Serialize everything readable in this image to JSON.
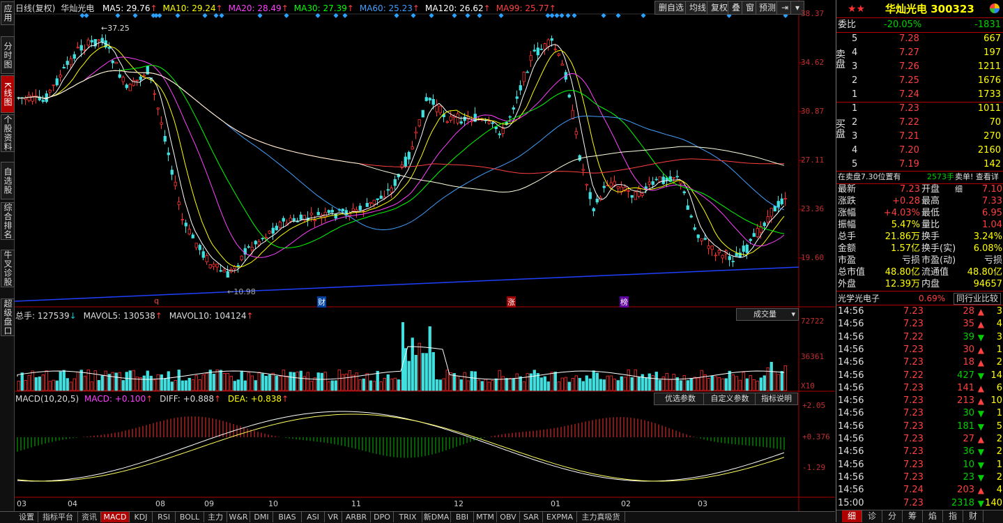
{
  "sidebar": {
    "tabs": [
      {
        "label": "应用",
        "active": false
      },
      {
        "label": "分时图",
        "active": false
      },
      {
        "label": "K线图",
        "active": true
      },
      {
        "label": "个股资料",
        "active": false
      },
      {
        "label": "自选股",
        "active": false
      },
      {
        "label": "综合排名",
        "active": false
      },
      {
        "label": "牛叉诊股",
        "active": false
      },
      {
        "label": "超级盘口",
        "active": false
      }
    ]
  },
  "header": {
    "period": "日线(复权)",
    "stock_name": "华灿光电",
    "ma_items": [
      {
        "label": "MA5: 29.76",
        "color": "#ffffff"
      },
      {
        "label": "MA10: 29.24",
        "color": "#ffff00"
      },
      {
        "label": "MA20: 28.49",
        "color": "#ff40ff"
      },
      {
        "label": "MA30: 27.39",
        "color": "#00ff00"
      },
      {
        "label": "MA60: 25.23",
        "color": "#40a0ff"
      },
      {
        "label": "MA120: 26.62",
        "color": "#ffffff"
      },
      {
        "label": "MA99: 25.77",
        "color": "#ff4040"
      }
    ],
    "tools": [
      "删自选",
      "均线",
      "复权",
      "叠",
      "窗",
      "预测"
    ]
  },
  "price_axis": [
    "38.37",
    "34.62",
    "30.87",
    "27.11",
    "23.36",
    "19.60"
  ],
  "annotations": {
    "high": "37.25",
    "low": "10.98"
  },
  "event_markers": [
    "q",
    "财",
    "涨",
    "榜"
  ],
  "volume": {
    "label_total": "总手: 127539",
    "label_mavol5": "MAVOL5: 130538",
    "label_mavol10": "MAVOL10: 104124",
    "axis": [
      "72722",
      "36361",
      "X10"
    ],
    "dropdown": "成交量"
  },
  "macd": {
    "title": "MACD(10,20,5)",
    "value": "MACD: +0.100",
    "diff": "DIFF: +0.888",
    "dea": "DEA: +0.838",
    "axis": [
      "+2.05",
      "+0.376",
      "-1.29"
    ],
    "buttons": [
      "优选参数",
      "自定义参数",
      "指标说明"
    ]
  },
  "x_axis": [
    "03",
    "04",
    "08",
    "09",
    "10",
    "11",
    "12",
    "01",
    "02",
    "03"
  ],
  "bottom_tabs": [
    "设置",
    "指标平台",
    "资讯",
    "MACD",
    "KDJ",
    "RSI",
    "BOLL",
    "主力",
    "W&R",
    "DMI",
    "BIAS",
    "ASI",
    "VR",
    "ARBR",
    "DPO",
    "TRIX",
    "新DMA",
    "BBI",
    "MTM",
    "OBV",
    "SAR",
    "EXPMA",
    "主力真吸货"
  ],
  "quote": {
    "title": "华灿光电 300323",
    "webi_label": "委比",
    "webi_pct": "-20.05%",
    "webi_diff": "-1831",
    "sell_label": "卖盘",
    "buy_label": "买盘",
    "asks": [
      {
        "level": "5",
        "price": "7.28",
        "vol": "667"
      },
      {
        "level": "4",
        "price": "7.27",
        "vol": "197"
      },
      {
        "level": "3",
        "price": "7.26",
        "vol": "1211"
      },
      {
        "level": "2",
        "price": "7.25",
        "vol": "1676"
      },
      {
        "level": "1",
        "price": "7.24",
        "vol": "1733"
      }
    ],
    "bids": [
      {
        "level": "1",
        "price": "7.23",
        "vol": "1011"
      },
      {
        "level": "2",
        "price": "7.22",
        "vol": "70"
      },
      {
        "level": "3",
        "price": "7.21",
        "vol": "270"
      },
      {
        "level": "4",
        "price": "7.20",
        "vol": "2160"
      },
      {
        "level": "5",
        "price": "7.19",
        "vol": "142"
      }
    ],
    "order_info_1": "在卖盘7.30位置有",
    "order_info_2": "2573手",
    "order_info_3": "卖单! 查看详细",
    "stats": [
      [
        "最新",
        "7.23",
        "开盘",
        "7.10"
      ],
      [
        "涨跌",
        "+0.28",
        "最高",
        "7.33"
      ],
      [
        "涨幅",
        "+4.03%",
        "最低",
        "6.95"
      ],
      [
        "振幅",
        "5.47%",
        "量比",
        "1.04"
      ],
      [
        "总手",
        "21.86万",
        "换手",
        "3.24%"
      ],
      [
        "金额",
        "1.57亿",
        "换手(实)",
        "6.08%"
      ],
      [
        "市盈",
        "亏损",
        "市盈(动)",
        "亏损"
      ],
      [
        "总市值",
        "48.80亿",
        "流通值",
        "48.80亿"
      ],
      [
        "外盘",
        "12.39万",
        "内盘",
        "94657"
      ]
    ],
    "industry": "光学光电子",
    "industry_pct": "0.69%",
    "industry_btn": "同行业比较",
    "ticks": [
      [
        "14:56",
        "7.23",
        "28",
        "up",
        "3"
      ],
      [
        "14:56",
        "7.23",
        "35",
        "up",
        "4"
      ],
      [
        "14:56",
        "7.22",
        "39",
        "down",
        "3"
      ],
      [
        "14:56",
        "7.23",
        "30",
        "up",
        "1"
      ],
      [
        "14:56",
        "7.23",
        "18",
        "up",
        "2"
      ],
      [
        "14:56",
        "7.22",
        "427",
        "down",
        "14"
      ],
      [
        "14:56",
        "7.23",
        "141",
        "up",
        "6"
      ],
      [
        "14:56",
        "7.23",
        "213",
        "up",
        "10"
      ],
      [
        "14:56",
        "7.23",
        "30",
        "down",
        "1"
      ],
      [
        "14:56",
        "7.23",
        "181",
        "down",
        "5"
      ],
      [
        "14:56",
        "7.23",
        "27",
        "up",
        "2"
      ],
      [
        "14:56",
        "7.23",
        "36",
        "down",
        "2"
      ],
      [
        "14:56",
        "7.23",
        "10",
        "down",
        "1"
      ],
      [
        "14:56",
        "7.23",
        "23",
        "down",
        "2"
      ],
      [
        "14:56",
        "7.24",
        "203",
        "up",
        "4"
      ],
      [
        "15:00",
        "7.23",
        "2318",
        "down",
        "140"
      ]
    ],
    "tabs": [
      "细",
      "诊",
      "分",
      "筹",
      "焰",
      "指",
      "财"
    ]
  }
}
